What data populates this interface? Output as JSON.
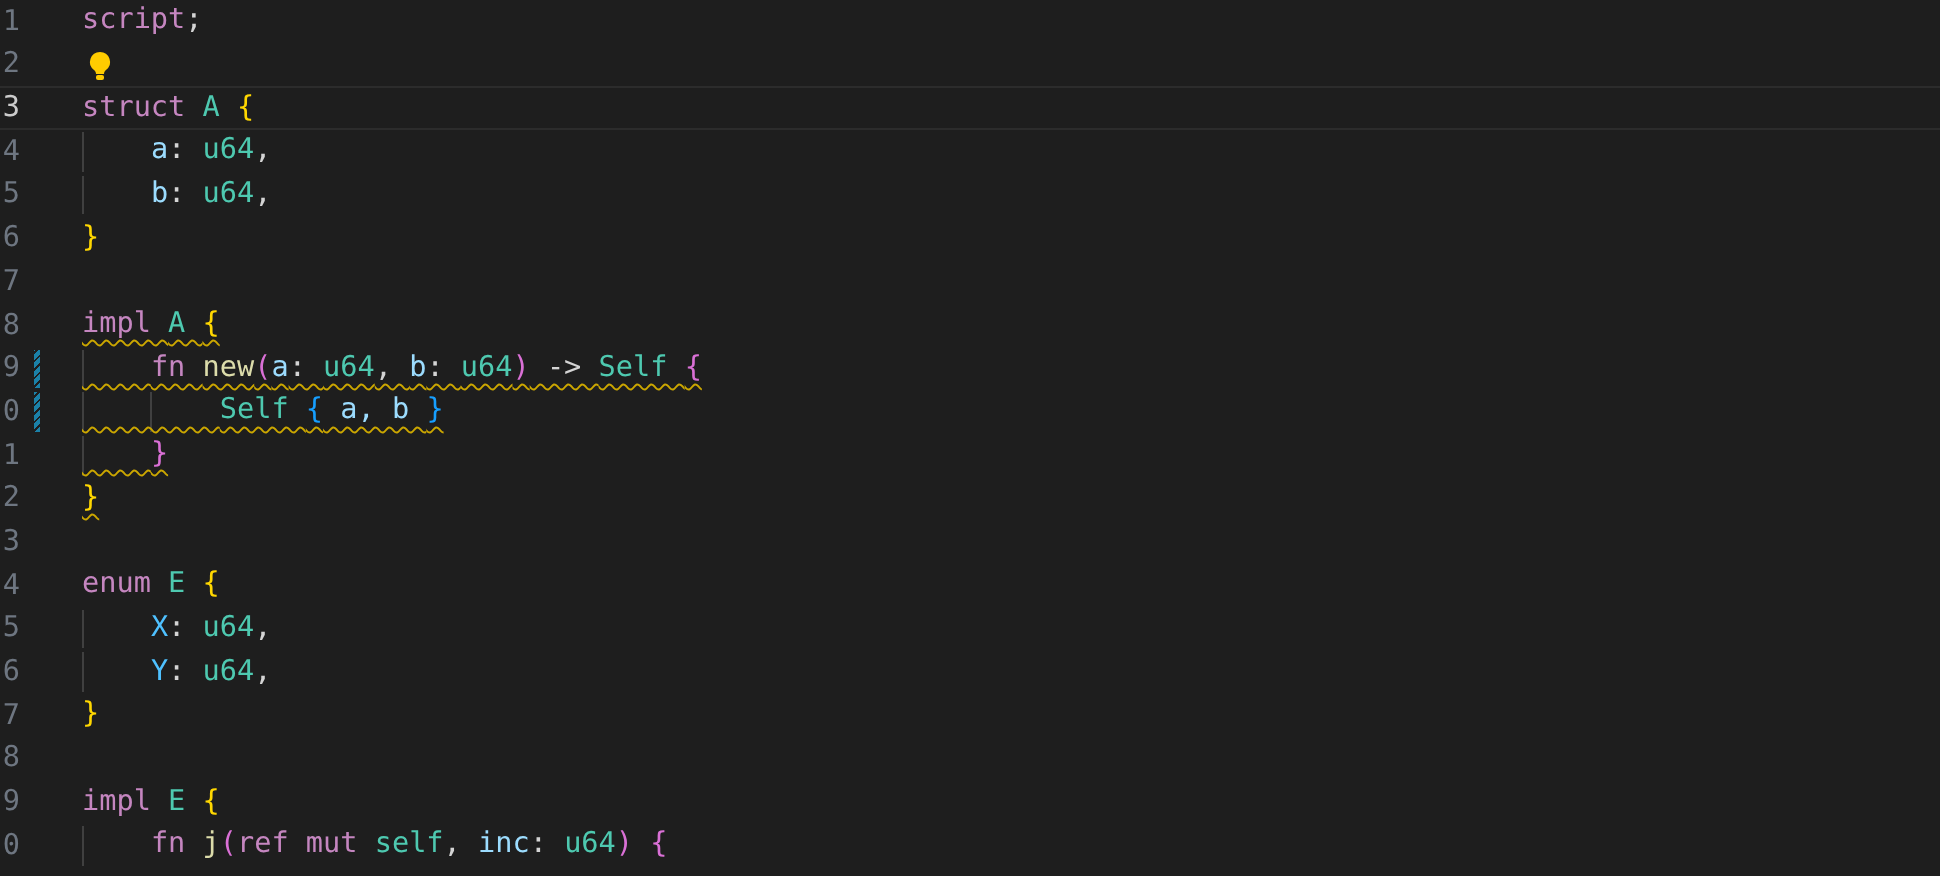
{
  "editor": {
    "lines": [
      {
        "number": "1",
        "kind": "top",
        "tokens": [
          {
            "text": "script",
            "kind": "keyword"
          },
          {
            "text": ";",
            "kind": "plain"
          }
        ]
      },
      {
        "number": "2",
        "kind": "blank",
        "lightbulb": true
      },
      {
        "number": "3",
        "kind": "top",
        "current": true,
        "tokens": [
          {
            "text": "struct ",
            "kind": "keyword"
          },
          {
            "text": "A ",
            "kind": "type"
          },
          {
            "text": "{",
            "kind": "brace1"
          }
        ]
      },
      {
        "number": "4",
        "kind": "nested",
        "tokens": [
          {
            "text": "a",
            "kind": "field"
          },
          {
            "text": ": ",
            "kind": "plain"
          },
          {
            "text": "u64",
            "kind": "type"
          },
          {
            "text": ",",
            "kind": "plain"
          }
        ]
      },
      {
        "number": "5",
        "kind": "nested",
        "tokens": [
          {
            "text": "b",
            "kind": "field"
          },
          {
            "text": ": ",
            "kind": "plain"
          },
          {
            "text": "u64",
            "kind": "type"
          },
          {
            "text": ",",
            "kind": "plain"
          }
        ]
      },
      {
        "number": "6",
        "kind": "top",
        "tokens": [
          {
            "text": "}",
            "kind": "brace1"
          }
        ]
      },
      {
        "number": "7",
        "kind": "blank"
      },
      {
        "number": "8",
        "kind": "top",
        "squiggle": true,
        "tokens": [
          {
            "text": "impl ",
            "kind": "keyword"
          },
          {
            "text": "A ",
            "kind": "type"
          },
          {
            "text": "{",
            "kind": "brace1"
          }
        ]
      },
      {
        "number": "9",
        "kind": "nested",
        "squiggle": true,
        "modified": true,
        "tokens": [
          {
            "text": "fn ",
            "kind": "keyword"
          },
          {
            "text": "new",
            "kind": "function"
          },
          {
            "text": "(",
            "kind": "brace2"
          },
          {
            "text": "a",
            "kind": "field"
          },
          {
            "text": ": ",
            "kind": "plain"
          },
          {
            "text": "u64",
            "kind": "type"
          },
          {
            "text": ", ",
            "kind": "plain"
          },
          {
            "text": "b",
            "kind": "field"
          },
          {
            "text": ": ",
            "kind": "plain"
          },
          {
            "text": "u64",
            "kind": "type"
          },
          {
            "text": ")",
            "kind": "brace2"
          },
          {
            "text": " -> ",
            "kind": "plain"
          },
          {
            "text": "Self ",
            "kind": "type"
          },
          {
            "text": "{",
            "kind": "brace2"
          }
        ]
      },
      {
        "number": "0",
        "kind": "body",
        "squiggle": true,
        "modified": true,
        "tokens": [
          {
            "text": "Self ",
            "kind": "type"
          },
          {
            "text": "{",
            "kind": "brace3"
          },
          {
            "text": " a, b ",
            "kind": "field"
          },
          {
            "text": "}",
            "kind": "brace3"
          }
        ]
      },
      {
        "number": "1",
        "kind": "nested",
        "squiggle": true,
        "tokens": [
          {
            "text": "}",
            "kind": "brace2"
          }
        ]
      },
      {
        "number": "2",
        "kind": "top",
        "squiggle": true,
        "tokens": [
          {
            "text": "}",
            "kind": "brace1"
          }
        ]
      },
      {
        "number": "3",
        "kind": "blank"
      },
      {
        "number": "4",
        "kind": "top",
        "tokens": [
          {
            "text": "enum ",
            "kind": "keyword"
          },
          {
            "text": "E ",
            "kind": "type"
          },
          {
            "text": "{",
            "kind": "brace1"
          }
        ]
      },
      {
        "number": "5",
        "kind": "nested",
        "tokens": [
          {
            "text": "X",
            "kind": "member"
          },
          {
            "text": ": ",
            "kind": "plain"
          },
          {
            "text": "u64",
            "kind": "type"
          },
          {
            "text": ",",
            "kind": "plain"
          }
        ]
      },
      {
        "number": "6",
        "kind": "nested",
        "tokens": [
          {
            "text": "Y",
            "kind": "member"
          },
          {
            "text": ": ",
            "kind": "plain"
          },
          {
            "text": "u64",
            "kind": "type"
          },
          {
            "text": ",",
            "kind": "plain"
          }
        ]
      },
      {
        "number": "7",
        "kind": "top",
        "tokens": [
          {
            "text": "}",
            "kind": "brace1"
          }
        ]
      },
      {
        "number": "8",
        "kind": "blank"
      },
      {
        "number": "9",
        "kind": "top",
        "tokens": [
          {
            "text": "impl ",
            "kind": "keyword"
          },
          {
            "text": "E ",
            "kind": "type"
          },
          {
            "text": "{",
            "kind": "brace1"
          }
        ]
      },
      {
        "number": "0",
        "kind": "nested",
        "tokens": [
          {
            "text": "fn ",
            "kind": "keyword"
          },
          {
            "text": "j",
            "kind": "function"
          },
          {
            "text": "(",
            "kind": "brace2"
          },
          {
            "text": "ref mut ",
            "kind": "keyword"
          },
          {
            "text": "self",
            "kind": "type"
          },
          {
            "text": ", ",
            "kind": "plain"
          },
          {
            "text": "inc",
            "kind": "field"
          },
          {
            "text": ": ",
            "kind": "plain"
          },
          {
            "text": "u64",
            "kind": "type"
          },
          {
            "text": ")",
            "kind": "brace2"
          },
          {
            "text": " {",
            "kind": "brace2"
          }
        ]
      }
    ]
  }
}
